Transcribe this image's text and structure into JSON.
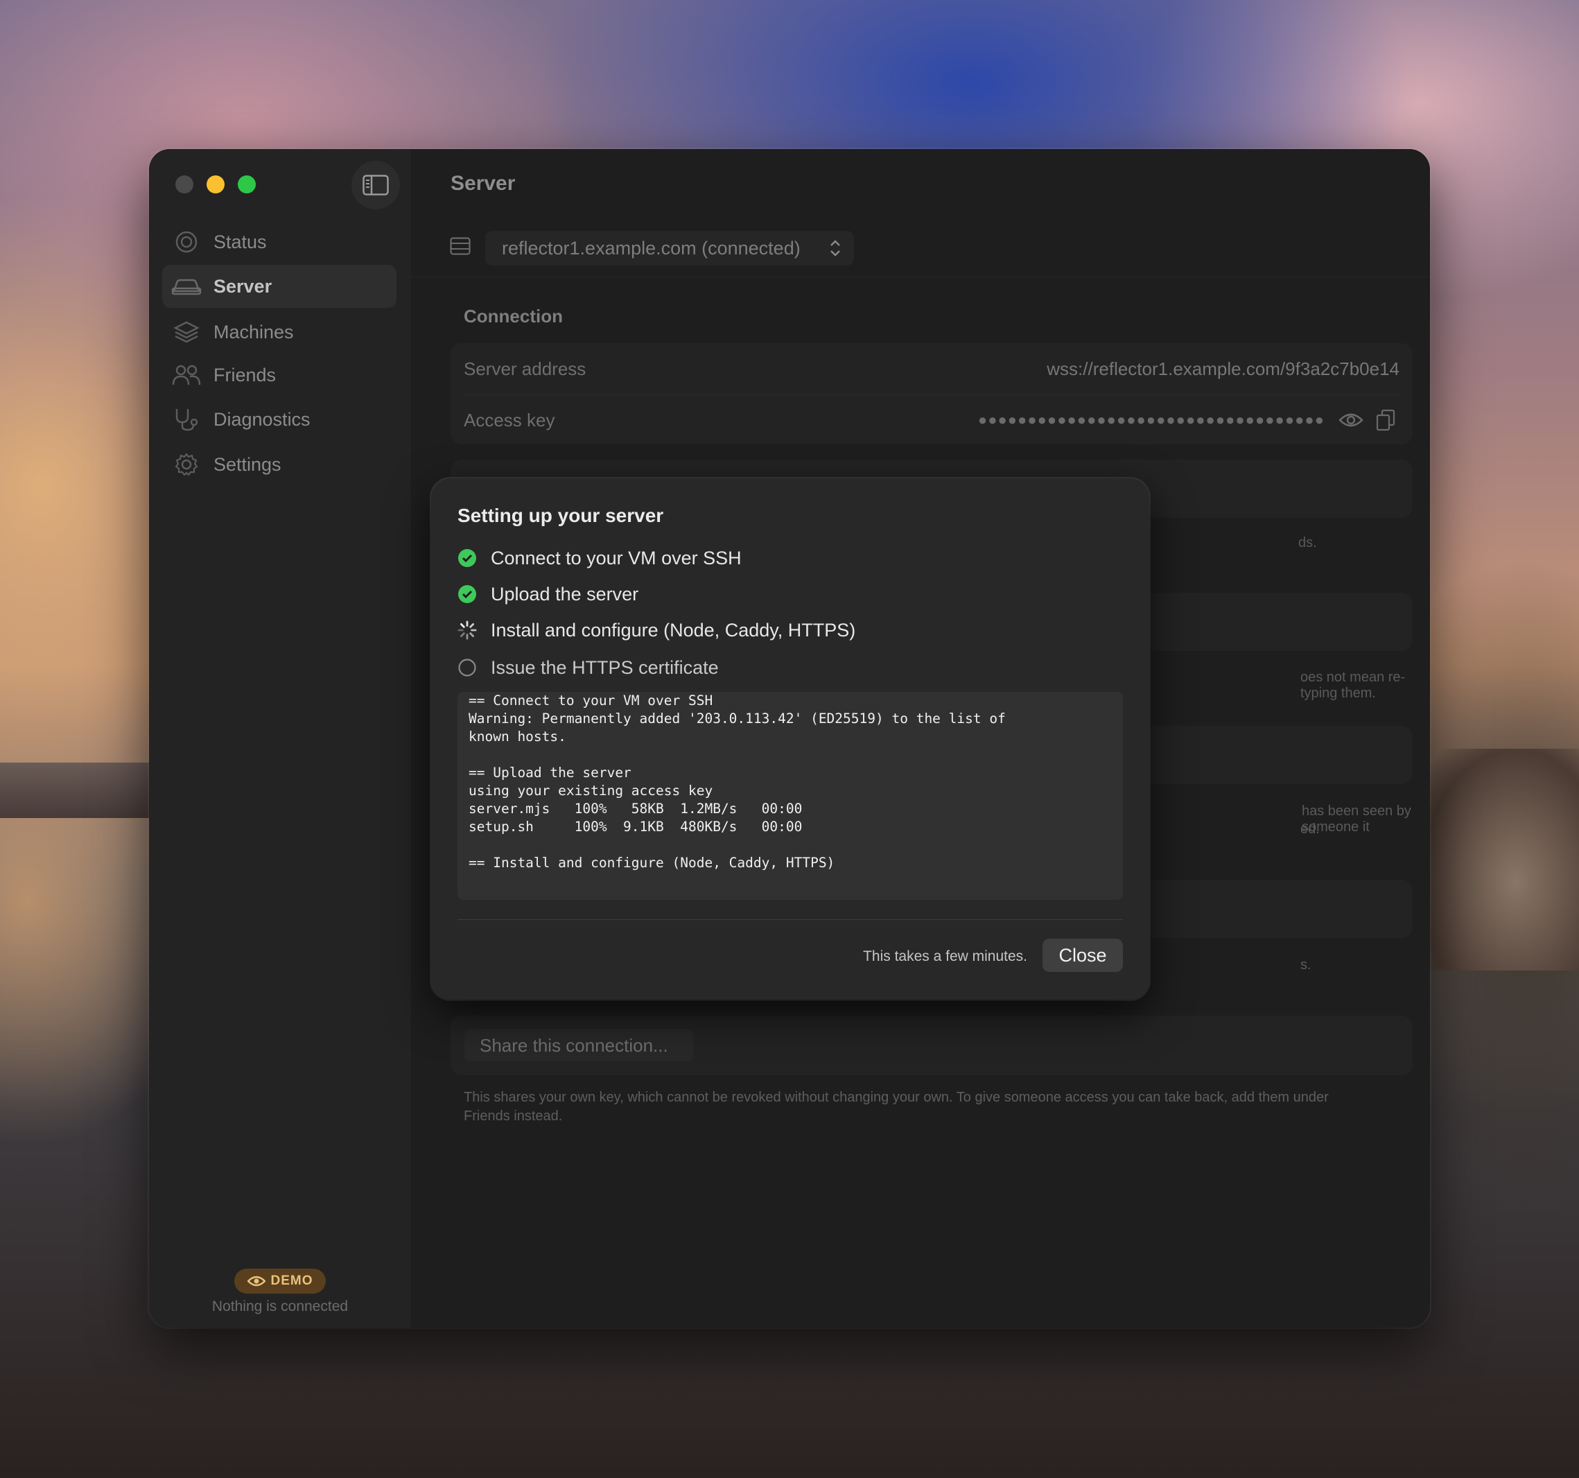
{
  "sidebar": {
    "items": [
      {
        "label": "Status",
        "icon": "status-circle-icon"
      },
      {
        "label": "Server",
        "icon": "server-car-icon",
        "active": true
      },
      {
        "label": "Machines",
        "icon": "stack-layers-icon"
      },
      {
        "label": "Friends",
        "icon": "people-icon"
      },
      {
        "label": "Diagnostics",
        "icon": "stethoscope-icon"
      },
      {
        "label": "Settings",
        "icon": "gear-icon"
      }
    ],
    "demo_badge": "DEMO",
    "status_text": "Nothing is connected"
  },
  "main": {
    "title": "Server",
    "server_select": "reflector1.example.com (connected)",
    "connection": {
      "section_title": "Connection",
      "server_address_label": "Server address",
      "server_address_value": "wss://reflector1.example.com/9f3a2c7b0e14",
      "access_key_label": "Access key",
      "access_key_masked": "●●●●●●●●●●●●●●●●●●●●●●●●●●●●●●●●●●●"
    },
    "partial_texts": {
      "t1": "ds.",
      "t2": "oes not mean re-typing them.",
      "t3a": "has been seen by someone it",
      "t3b": "ed.",
      "t4": "s."
    },
    "share_button": "Share this connection...",
    "share_footnote": "This shares your own key, which cannot be revoked without changing your own. To give someone access you can take back, add them under Friends instead."
  },
  "dialog": {
    "title": "Setting up your server",
    "steps": [
      {
        "label": "Connect to your VM over SSH",
        "state": "done"
      },
      {
        "label": "Upload the server",
        "state": "done"
      },
      {
        "label": "Install and configure (Node, Caddy, HTTPS)",
        "state": "in-progress"
      },
      {
        "label": "Issue the HTTPS certificate",
        "state": "pending"
      }
    ],
    "log": [
      "== Connect to your VM over SSH",
      "Warning: Permanently added '203.0.113.42' (ED25519) to the list of",
      "known hosts.",
      "",
      "== Upload the server",
      "using your existing access key",
      "server.mjs   100%   58KB  1.2MB/s   00:00",
      "setup.sh     100%  9.1KB  480KB/s   00:00",
      "",
      "== Install and configure (Node, Caddy, HTTPS)"
    ],
    "note": "This takes a few minutes.",
    "close_label": "Close"
  },
  "colors": {
    "traffic_close": "#4a4a4a",
    "traffic_minimize": "#fbc02f",
    "traffic_maximize": "#2fc748",
    "success": "#3ec95a",
    "demo_badge_bg": "#5a3f1e",
    "demo_badge_fg": "#e9c27a"
  }
}
